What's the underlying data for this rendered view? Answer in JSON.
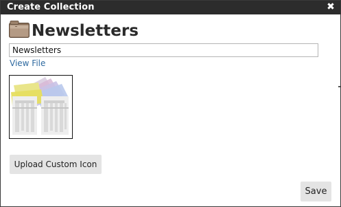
{
  "dialog": {
    "title": "Create Collection",
    "close_glyph": "✖",
    "close_icon": "close-icon"
  },
  "collection": {
    "heading": "Newsletters",
    "heading_icon": "folder-icon",
    "name_value": "Newsletters",
    "view_file_label": "View File",
    "thumbnail_icon": "newsletter-thumbnail"
  },
  "actions": {
    "upload_label": "Upload Custom Icon",
    "save_label": "Save"
  },
  "colors": {
    "titlebar": "#2c2c2c",
    "link": "#2f6aa0",
    "button_bg": "#e4e4e4"
  }
}
